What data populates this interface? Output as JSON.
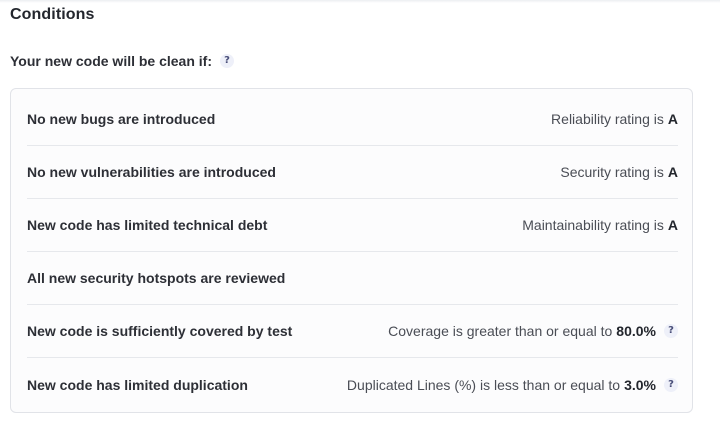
{
  "section": {
    "title": "Conditions",
    "subtitle": "Your new code will be clean if:",
    "help_glyph": "?"
  },
  "conditions": [
    {
      "label": "No new bugs are introduced",
      "detail": "Reliability rating is",
      "value": "A",
      "has_help": false
    },
    {
      "label": "No new vulnerabilities are introduced",
      "detail": "Security rating is",
      "value": "A",
      "has_help": false
    },
    {
      "label": "New code has limited technical debt",
      "detail": "Maintainability rating is",
      "value": "A",
      "has_help": false
    },
    {
      "label": "All new security hotspots are reviewed",
      "detail": "",
      "value": "",
      "has_help": false
    },
    {
      "label": "New code is sufficiently covered by test",
      "detail": "Coverage is greater than or equal to",
      "value": "80.0%",
      "has_help": true
    },
    {
      "label": "New code has limited duplication",
      "detail": "Duplicated Lines (%) is less than or equal to",
      "value": "3.0%",
      "has_help": true
    }
  ],
  "icons": {
    "help": "question-mark-icon"
  },
  "colors": {
    "help_icon_bg": "#eef0f9",
    "help_icon_fg": "#4a4f7a",
    "card_border": "#e1e3e8"
  }
}
